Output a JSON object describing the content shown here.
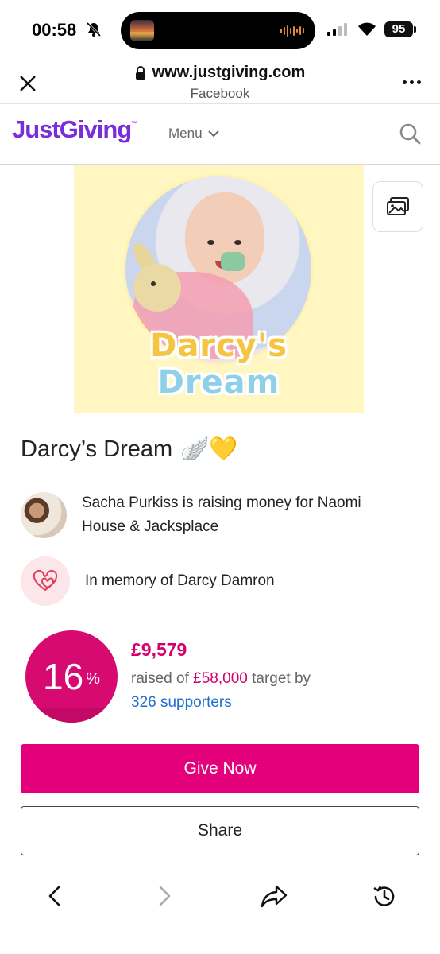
{
  "status_bar": {
    "time": "00:58",
    "battery": "95"
  },
  "browser": {
    "url": "www.justgiving.com",
    "source": "Facebook"
  },
  "header": {
    "logo": "JustGiving",
    "logo_tm": "™",
    "menu_label": "Menu"
  },
  "hero": {
    "title_line1": "Darcy's",
    "title_line2": "Dream"
  },
  "page": {
    "title": "Darcy’s Dream",
    "title_emoji": "🪽💛",
    "organiser_text": "Sacha Purkiss is raising money for Naomi House & Jacksplace",
    "memory_text": "In memory of Darcy Damron"
  },
  "progress": {
    "percent": "16",
    "percent_sign": "%",
    "fill_fraction": 0.16,
    "raised": "£9,579",
    "raised_of": "raised of ",
    "target_amount": "£58,000",
    "target_by": " target by",
    "supporters": "326 supporters"
  },
  "actions": {
    "give": "Give Now",
    "share": "Share"
  },
  "colors": {
    "brand": "#7a2ed8",
    "accent": "#e3007a",
    "link": "#1f6fcf"
  },
  "icons": [
    "close-icon",
    "lock-icon",
    "more-icon",
    "chevron-down-icon",
    "search-icon",
    "gallery-icon",
    "heart-icon",
    "back-icon",
    "forward-icon",
    "share-icon",
    "history-icon"
  ]
}
